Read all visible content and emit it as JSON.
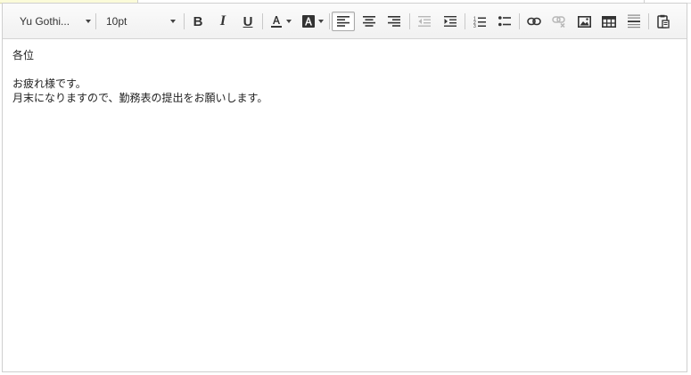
{
  "toolbar": {
    "font_family": "Yu Gothi...",
    "font_size": "10pt",
    "buttons": {
      "bold": "B",
      "italic": "I",
      "underline": "U"
    }
  },
  "body": {
    "lines": [
      "各位",
      "",
      "お疲れ様です。",
      "月末になりますので、勤務表の提出をお願いします。"
    ]
  },
  "icons": {
    "bold": "bold-icon",
    "italic": "italic-icon",
    "underline": "underline-icon",
    "text_color": "text-color-icon",
    "bg_color": "background-color-icon",
    "align_left": "align-left-icon",
    "align_center": "align-center-icon",
    "align_right": "align-right-icon",
    "outdent": "outdent-icon",
    "indent": "indent-icon",
    "ordered_list": "ordered-list-icon",
    "unordered_list": "unordered-list-icon",
    "link": "link-icon",
    "unlink": "unlink-icon",
    "image": "image-icon",
    "table": "table-icon",
    "horizontal_rule": "horizontal-rule-icon",
    "paste": "paste-icon"
  },
  "colors": {
    "toolbar_bg": "#f3f3f3",
    "border": "#cfcfcf",
    "text": "#222222",
    "disabled": "#b7b7b7",
    "top_highlight": "#fbfbd9"
  }
}
